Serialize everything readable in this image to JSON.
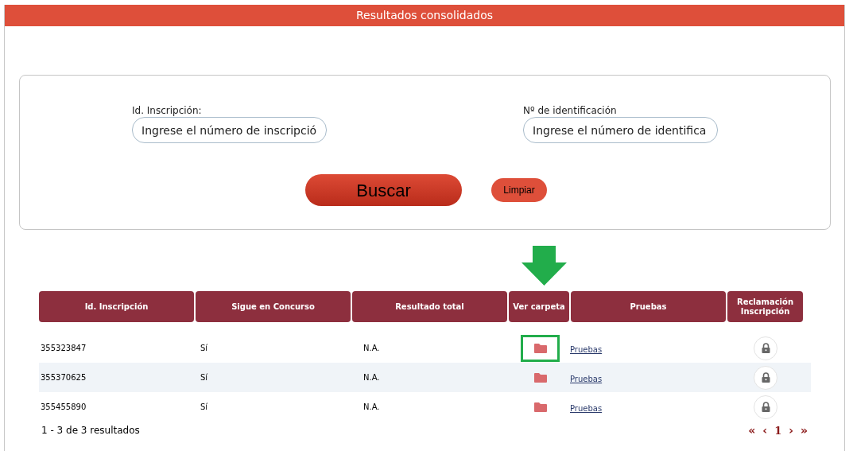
{
  "header": {
    "title": "Resultados consolidados"
  },
  "search": {
    "fields": [
      {
        "label": "Id. Inscripción:",
        "placeholder": "Ingrese el número de inscripció"
      },
      {
        "label": "Nº de identificación",
        "placeholder": "Ingrese el número de identifica"
      }
    ],
    "buttons": [
      {
        "label": "Buscar",
        "kind": "primary"
      },
      {
        "label": "Limpiar",
        "kind": "secondary"
      }
    ]
  },
  "table": {
    "columns": [
      "Id. Inscripción",
      "Sigue en Concurso",
      "Resultado total",
      "Ver carpeta",
      "Pruebas",
      "Reclamación Inscripción"
    ],
    "rows": [
      {
        "id": "355323847",
        "sigue": "Sí",
        "resultado": "N.A.",
        "pruebas": "Pruebas",
        "highlighted": true
      },
      {
        "id": "355370625",
        "sigue": "Sí",
        "resultado": "N.A.",
        "pruebas": "Pruebas",
        "highlighted": false
      },
      {
        "id": "355455890",
        "sigue": "Sí",
        "resultado": "N.A.",
        "pruebas": "Pruebas",
        "highlighted": false
      }
    ]
  },
  "footer": {
    "summary": "1 - 3 de 3 resultados",
    "pagination": [
      {
        "label": "«",
        "kind": "first"
      },
      {
        "label": "‹",
        "kind": "prev"
      },
      {
        "label": "1",
        "kind": "page"
      },
      {
        "label": "›",
        "kind": "next"
      },
      {
        "label": "»",
        "kind": "last"
      }
    ]
  }
}
